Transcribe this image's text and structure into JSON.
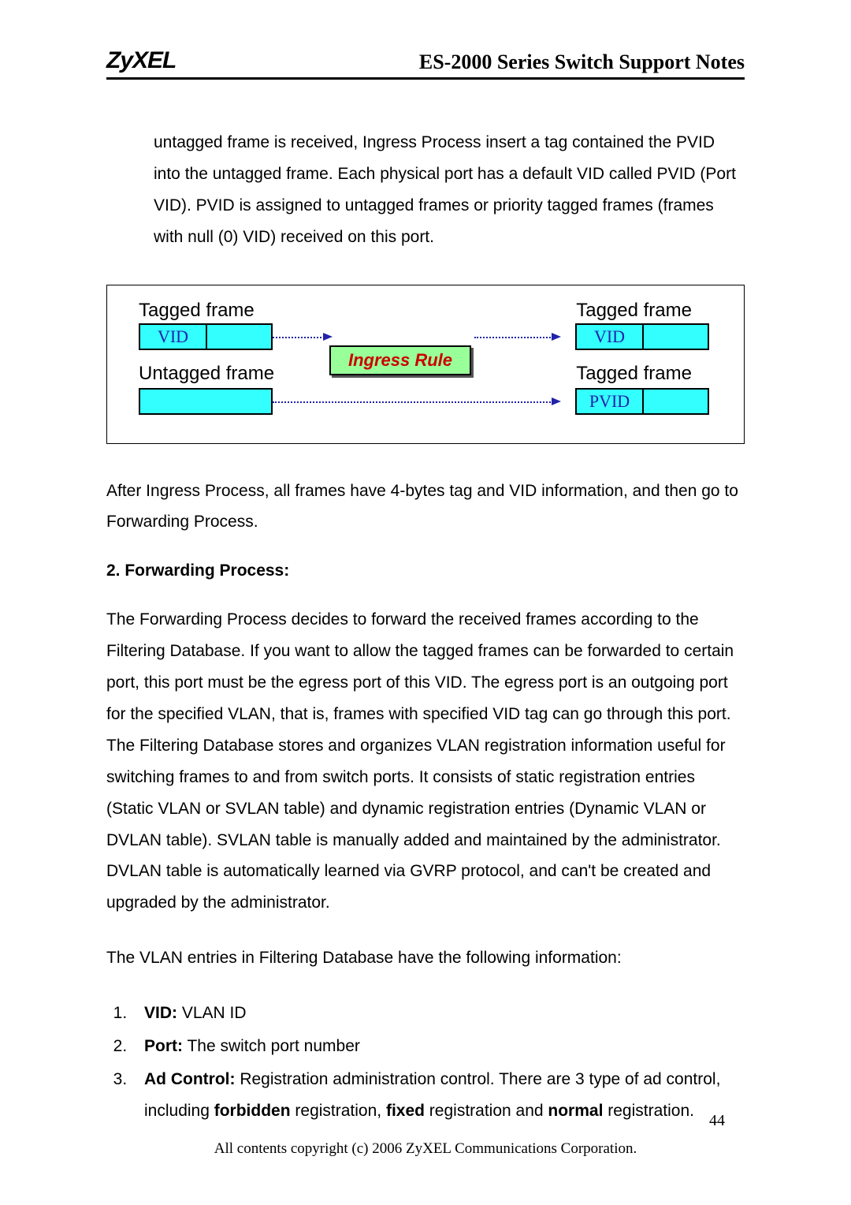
{
  "header": {
    "logo": "ZyXEL",
    "doc_title": "ES-2000 Series Switch Support Notes"
  },
  "intro_para": "untagged frame is received, Ingress Process insert a tag contained the PVID into the untagged frame. Each physical port has a default VID called PVID (Port VID). PVID is assigned to untagged frames or priority tagged frames (frames with null (0) VID) received on this port.",
  "diagram": {
    "tagged_frame": "Tagged frame",
    "untagged_frame": "Untagged frame",
    "vid": "VID",
    "pvid": "PVID",
    "ingress_rule": "Ingress Rule"
  },
  "after_para": "After Ingress Process, all frames have 4-bytes tag and VID information, and then go to Forwarding Process.",
  "section2_heading": "2. Forwarding Process:",
  "section2_para": "The Forwarding Process decides to forward the received frames according to the Filtering Database. If you want to allow the tagged frames can be forwarded to certain port, this port must be the egress port of this VID. The egress port is an outgoing port for the specified VLAN, that is, frames with specified VID tag can go through this port. The Filtering Database stores and organizes VLAN registration information useful for switching frames to and from switch ports. It consists of static registration entries (Static VLAN or SVLAN table) and dynamic registration entries (Dynamic VLAN or DVLAN table). SVLAN table is manually added and maintained by the administrator. DVLAN table is automatically learned via GVRP protocol, and can't be created and upgraded by the administrator.",
  "filter_intro": "The VLAN entries in Filtering Database have the following information:",
  "list": {
    "i1_b": "VID:",
    "i1_t": " VLAN ID",
    "i2_b": "Port:",
    "i2_t": " The switch port number",
    "i3_b": "Ad Control:",
    "i3_t1": " Registration administration control. There are 3 type of ad control, including ",
    "i3_b2": "forbidden",
    "i3_t2": " registration, ",
    "i3_b3": "fixed",
    "i3_t3": " registration and ",
    "i3_b4": "normal",
    "i3_t4": " registration."
  },
  "page_number": "44",
  "copyright": "All contents copyright (c) 2006 ZyXEL Communications Corporation."
}
